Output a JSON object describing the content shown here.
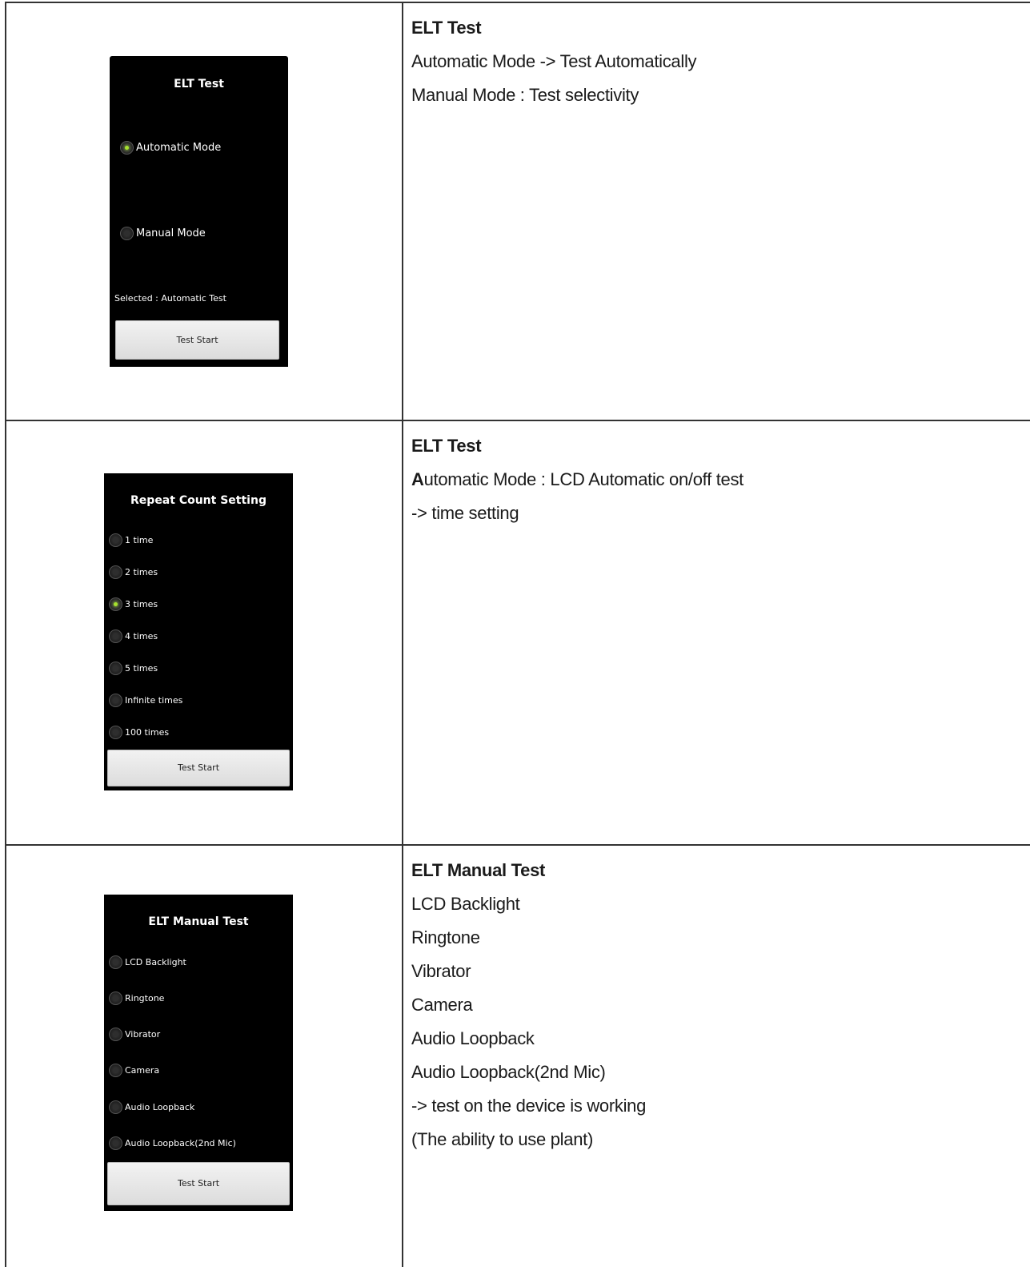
{
  "rows": [
    {
      "screen": {
        "title": "ELT Test",
        "options": [
          {
            "label": "Automatic Mode",
            "checked": true
          },
          {
            "label": "Manual Mode",
            "checked": false
          }
        ],
        "status": "Selected : Automatic Test",
        "button": "Test Start"
      },
      "description": [
        "ELT Test",
        "Automatic Mode -> Test Automatically",
        "Manual Mode : Test selectivity"
      ]
    },
    {
      "screen": {
        "title": "Repeat Count Setting",
        "options": [
          {
            "label": "1 time",
            "checked": false
          },
          {
            "label": "2 times",
            "checked": false
          },
          {
            "label": "3 times",
            "checked": true
          },
          {
            "label": "4 times",
            "checked": false
          },
          {
            "label": "5 times",
            "checked": false
          },
          {
            "label": "Infinite times",
            "checked": false
          },
          {
            "label": "100 times",
            "checked": false
          }
        ],
        "button": "Test Start"
      },
      "description": [
        "ELT Test",
        "Automatic Mode : LCD Automatic on/off test",
        " -> time setting"
      ],
      "description_first_letter_bold": "A",
      "description_rest": "utomatic Mode : LCD Automatic on/off test"
    },
    {
      "screen": {
        "title": "ELT Manual Test",
        "options": [
          {
            "label": "LCD Backlight",
            "checked": false
          },
          {
            "label": "Ringtone",
            "checked": false
          },
          {
            "label": "Vibrator",
            "checked": false
          },
          {
            "label": "Camera",
            "checked": false
          },
          {
            "label": "Audio Loopback",
            "checked": false
          },
          {
            "label": "Audio Loopback(2nd Mic)",
            "checked": false
          }
        ],
        "button": "Test Start"
      },
      "description": [
        "ELT Manual Test",
        "LCD Backlight",
        "Ringtone",
        "Vibrator",
        "Camera",
        "Audio Loopback",
        "Audio Loopback(2nd Mic)",
        "-> test on the device is working",
        "(The ability to use plant)"
      ]
    }
  ],
  "colors": {
    "screen_background": "#000000",
    "radio_checked": "#a6e22e",
    "button_background": "#e6e6e6",
    "border": "#333333"
  }
}
